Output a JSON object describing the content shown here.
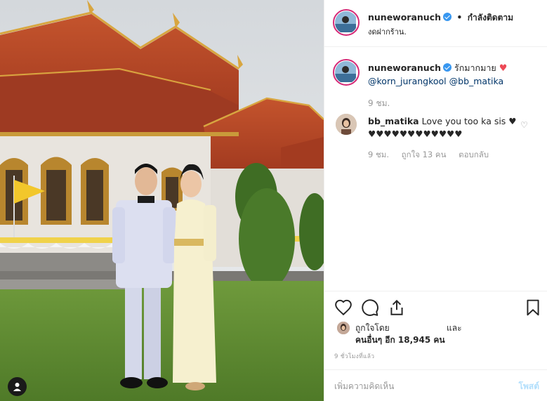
{
  "post": {
    "username": "nuneworanuch",
    "follow_state": "กำลังติดตาม",
    "location": "งดฝากร้าน."
  },
  "caption": {
    "username": "nuneworanuch",
    "text": "รักมากมาย",
    "heart": "♥",
    "mention_1": "@korn_jurangkool",
    "mention_2": "@bb_matika",
    "time": "9 ชม."
  },
  "comment": {
    "username": "bb_matika",
    "text": "Love you too ka sis ♥",
    "hearts": "♥♥♥♥♥♥♥♥♥♥♥♥",
    "time": "9 ชม.",
    "likes": "ถูกใจ 13 คน",
    "reply": "ตอบกลับ"
  },
  "likes": {
    "liked_by": "ถูกใจโดย",
    "and": "และ",
    "others": "คนอื่นๆ อีก 18,945 คน"
  },
  "timestamp": "9 ชั่วโมงที่แล้ว",
  "comment_box": {
    "placeholder": "เพิ่มความคิดเห็น",
    "post_label": "โพสต์"
  },
  "icons": {
    "like": "heart-outline-icon",
    "comment": "speech-bubble-icon",
    "share": "share-arrow-icon",
    "save": "bookmark-icon",
    "tags": "user-tag-icon",
    "verified": "verified-badge-icon"
  },
  "colors": {
    "verified_blue": "#3897f0",
    "mention": "#003569",
    "heart_red": "#ed4956",
    "post_button_disabled": "#b2dffc",
    "muted": "#999999"
  }
}
